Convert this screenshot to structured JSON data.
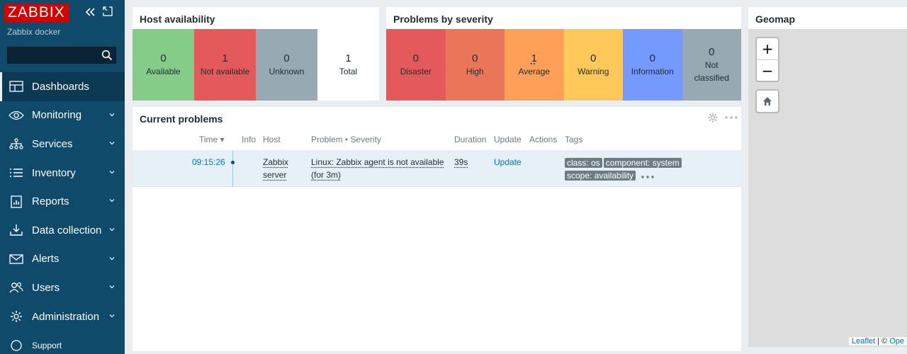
{
  "app": {
    "logo": "ZABBIX",
    "instance": "Zabbix docker"
  },
  "search": {
    "value": "",
    "placeholder": ""
  },
  "menu": {
    "items": [
      {
        "label": "Dashboards",
        "icon": "dashboards-icon",
        "active": true
      },
      {
        "label": "Monitoring",
        "icon": "eye-icon"
      },
      {
        "label": "Services",
        "icon": "services-icon"
      },
      {
        "label": "Inventory",
        "icon": "list-icon"
      },
      {
        "label": "Reports",
        "icon": "report-icon"
      },
      {
        "label": "Data collection",
        "icon": "download-icon"
      },
      {
        "label": "Alerts",
        "icon": "envelope-icon"
      },
      {
        "label": "Users",
        "icon": "users-icon"
      },
      {
        "label": "Administration",
        "icon": "gear-icon"
      },
      {
        "label": "Support",
        "icon": "support-icon"
      }
    ]
  },
  "host_availability": {
    "title": "Host availability",
    "tiles": [
      {
        "count": "0",
        "label": "Available",
        "color": "#86cc89"
      },
      {
        "count": "1",
        "label": "Not available",
        "color": "#e45959"
      },
      {
        "count": "0",
        "label": "Unknown",
        "color": "#97aab3"
      },
      {
        "count": "1",
        "label": "Total",
        "color": "#ffffff"
      }
    ]
  },
  "problems_by_severity": {
    "title": "Problems by severity",
    "tiles": [
      {
        "count": "0",
        "label": "Disaster",
        "color": "#e45959"
      },
      {
        "count": "0",
        "label": "High",
        "color": "#e97659"
      },
      {
        "count": "1",
        "label": "Average",
        "color": "#ffa059"
      },
      {
        "count": "0",
        "label": "Warning",
        "color": "#ffc859"
      },
      {
        "count": "0",
        "label": "Information",
        "color": "#7499ff"
      },
      {
        "count": "0",
        "label": "Not classified",
        "color": "#97aab3"
      }
    ]
  },
  "current_problems": {
    "title": "Current problems",
    "columns": {
      "time": "Time ▾",
      "info": "Info",
      "host": "Host",
      "problem": "Problem • Severity",
      "duration": "Duration",
      "update": "Update",
      "actions": "Actions",
      "tags": "Tags"
    },
    "rows": [
      {
        "time": "09:15:26",
        "host": "Zabbix server",
        "problem": "Linux: Zabbix agent is not available (for 3m)",
        "duration": "39s",
        "update": "Update",
        "tags": [
          "class: os",
          "component: system",
          "scope: availability"
        ]
      }
    ]
  },
  "geomap": {
    "title": "Geomap",
    "zoom_in": "+",
    "zoom_out": "−",
    "attribution_link": "Leaflet",
    "attribution_sep": " | © ",
    "attribution_rest": "Ope"
  }
}
